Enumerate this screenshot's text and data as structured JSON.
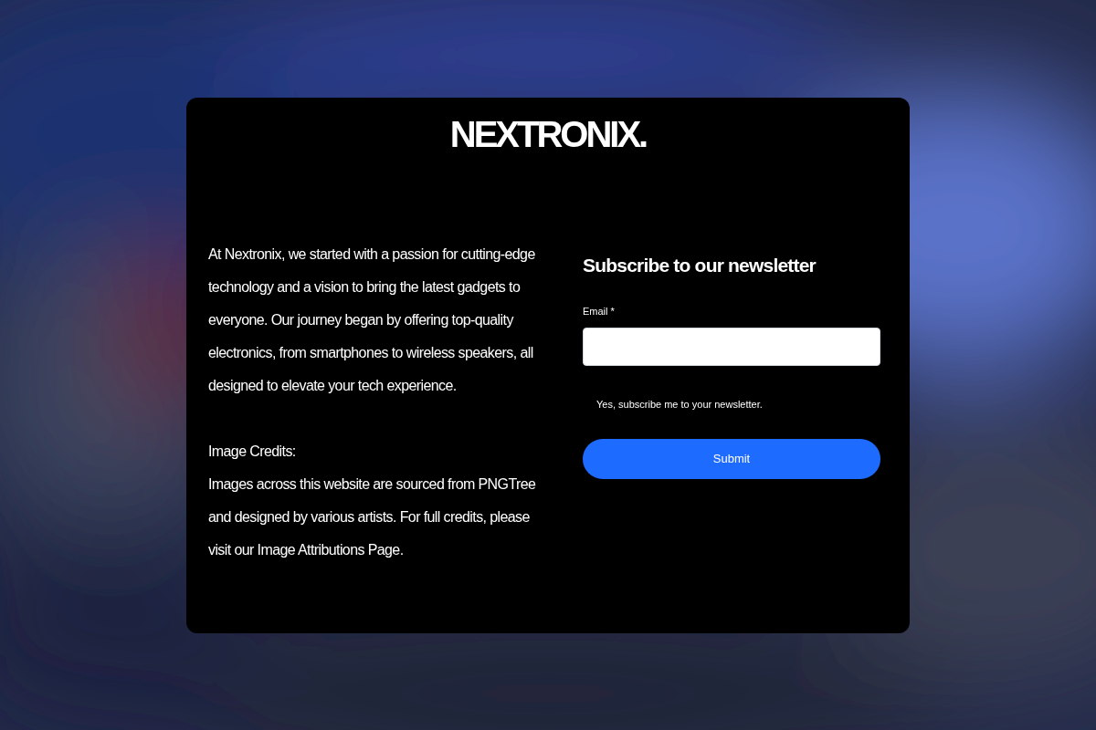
{
  "logo": "NEXTRONIX.",
  "about": {
    "intro": "At Nextronix, we started with a passion for cutting-edge technology and a vision to bring the latest gadgets to everyone. Our journey began by offering top-quality electronics, from smartphones to wireless speakers, all designed to elevate your tech experience.",
    "credits_heading": "Image Credits:",
    "credits_text": "Images across this website are sourced from PNGTree and designed by various artists. For full credits, please visit our Image Attributions Page."
  },
  "newsletter": {
    "title": "Subscribe to our newsletter",
    "email_label": "Email *",
    "consent_label": "Yes, subscribe me to your newsletter.",
    "submit": "Submit"
  }
}
